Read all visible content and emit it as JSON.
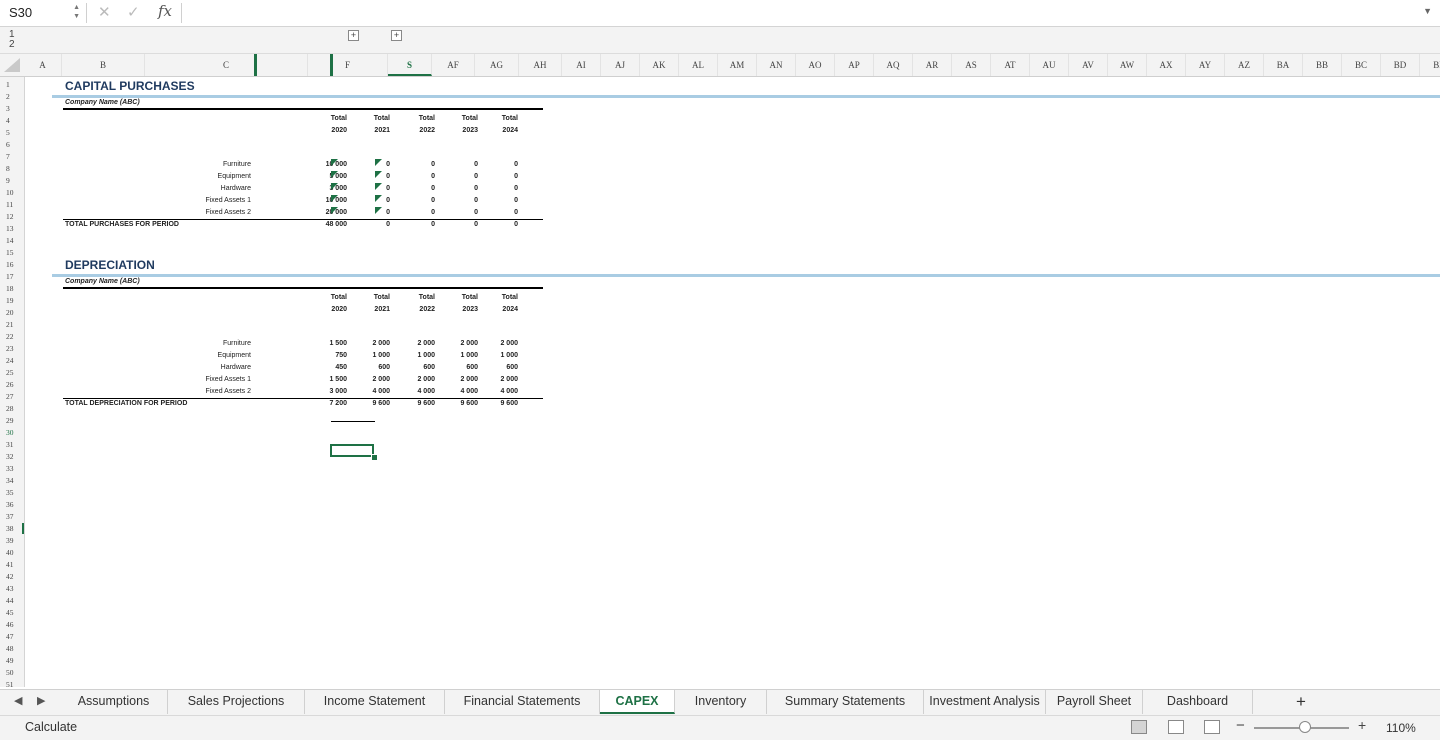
{
  "formula_bar": {
    "name_box": "S30",
    "cancel_icon": "close-icon",
    "enter_icon": "check-icon",
    "fx_label": "fx",
    "formula": ""
  },
  "outline": {
    "levels": [
      "1",
      "2"
    ],
    "expand_label": "+"
  },
  "columns": [
    "A",
    "B",
    "C",
    "F",
    "S",
    "AF",
    "AG",
    "AH",
    "AI",
    "AJ",
    "AK",
    "AL",
    "AM",
    "AN",
    "AO",
    "AP",
    "AQ",
    "AR",
    "AS",
    "AT",
    "AU",
    "AV",
    "AW",
    "AX",
    "AY",
    "AZ",
    "BA",
    "BB",
    "BC",
    "BD",
    "BE",
    "BF"
  ],
  "rows": [
    "1",
    "2",
    "3",
    "4",
    "5",
    "6",
    "7",
    "8",
    "9",
    "10",
    "11",
    "12",
    "13",
    "14",
    "15",
    "16",
    "17",
    "18",
    "19",
    "20",
    "21",
    "22",
    "23",
    "24",
    "25",
    "26",
    "27",
    "28",
    "29",
    "30",
    "31",
    "32",
    "33",
    "34",
    "35",
    "36",
    "37",
    "38",
    "39",
    "40",
    "41",
    "42",
    "43",
    "44",
    "45",
    "46",
    "47",
    "48",
    "49",
    "50",
    "51"
  ],
  "capex": {
    "title": "CAPITAL PURCHASES",
    "company": "Company Name (ABC)",
    "years": [
      {
        "label": "Total",
        "year": "2020"
      },
      {
        "label": "Total",
        "year": "2021"
      },
      {
        "label": "Total",
        "year": "2022"
      },
      {
        "label": "Total",
        "year": "2023"
      },
      {
        "label": "Total",
        "year": "2024"
      }
    ],
    "items": [
      {
        "label": "Furniture",
        "values": [
          "10 000",
          "0",
          "0",
          "0",
          "0"
        ]
      },
      {
        "label": "Equipment",
        "values": [
          "5 000",
          "0",
          "0",
          "0",
          "0"
        ]
      },
      {
        "label": "Hardware",
        "values": [
          "3 000",
          "0",
          "0",
          "0",
          "0"
        ]
      },
      {
        "label": "Fixed Assets 1",
        "values": [
          "10 000",
          "0",
          "0",
          "0",
          "0"
        ]
      },
      {
        "label": "Fixed Assets 2",
        "values": [
          "20 000",
          "0",
          "0",
          "0",
          "0"
        ]
      }
    ],
    "total_label": "TOTAL PURCHASES FOR PERIOD",
    "totals": [
      "48 000",
      "0",
      "0",
      "0",
      "0"
    ]
  },
  "depreciation": {
    "title": "DEPRECIATION",
    "company": "Company Name (ABC)",
    "years": [
      {
        "label": "Total",
        "year": "2020"
      },
      {
        "label": "Total",
        "year": "2021"
      },
      {
        "label": "Total",
        "year": "2022"
      },
      {
        "label": "Total",
        "year": "2023"
      },
      {
        "label": "Total",
        "year": "2024"
      }
    ],
    "items": [
      {
        "label": "Furniture",
        "values": [
          "1 500",
          "2 000",
          "2 000",
          "2 000",
          "2 000"
        ]
      },
      {
        "label": "Equipment",
        "values": [
          "750",
          "1 000",
          "1 000",
          "1 000",
          "1 000"
        ]
      },
      {
        "label": "Hardware",
        "values": [
          "450",
          "600",
          "600",
          "600",
          "600"
        ]
      },
      {
        "label": "Fixed Assets 1",
        "values": [
          "1 500",
          "2 000",
          "2 000",
          "2 000",
          "2 000"
        ]
      },
      {
        "label": "Fixed Assets 2",
        "values": [
          "3 000",
          "4 000",
          "4 000",
          "4 000",
          "4 000"
        ]
      }
    ],
    "total_label": "TOTAL DEPRECIATION FOR PERIOD",
    "totals": [
      "7 200",
      "9 600",
      "9 600",
      "9 600",
      "9 600"
    ]
  },
  "tabs": [
    "Assumptions",
    "Sales Projections",
    "Income Statement",
    "Financial Statements",
    "CAPEX",
    "Inventory",
    "Summary Statements",
    "Investment Analysis",
    "Payroll Sheet",
    "Dashboard"
  ],
  "active_tab": "CAPEX",
  "add_sheet_label": "+",
  "status": {
    "mode": "Calculate",
    "zoom": "110%",
    "zoom_minus": "−",
    "zoom_plus": "+"
  },
  "colors": {
    "accent": "#1e7145",
    "section_rule": "#a9cce3",
    "title": "#1f3a5f"
  }
}
